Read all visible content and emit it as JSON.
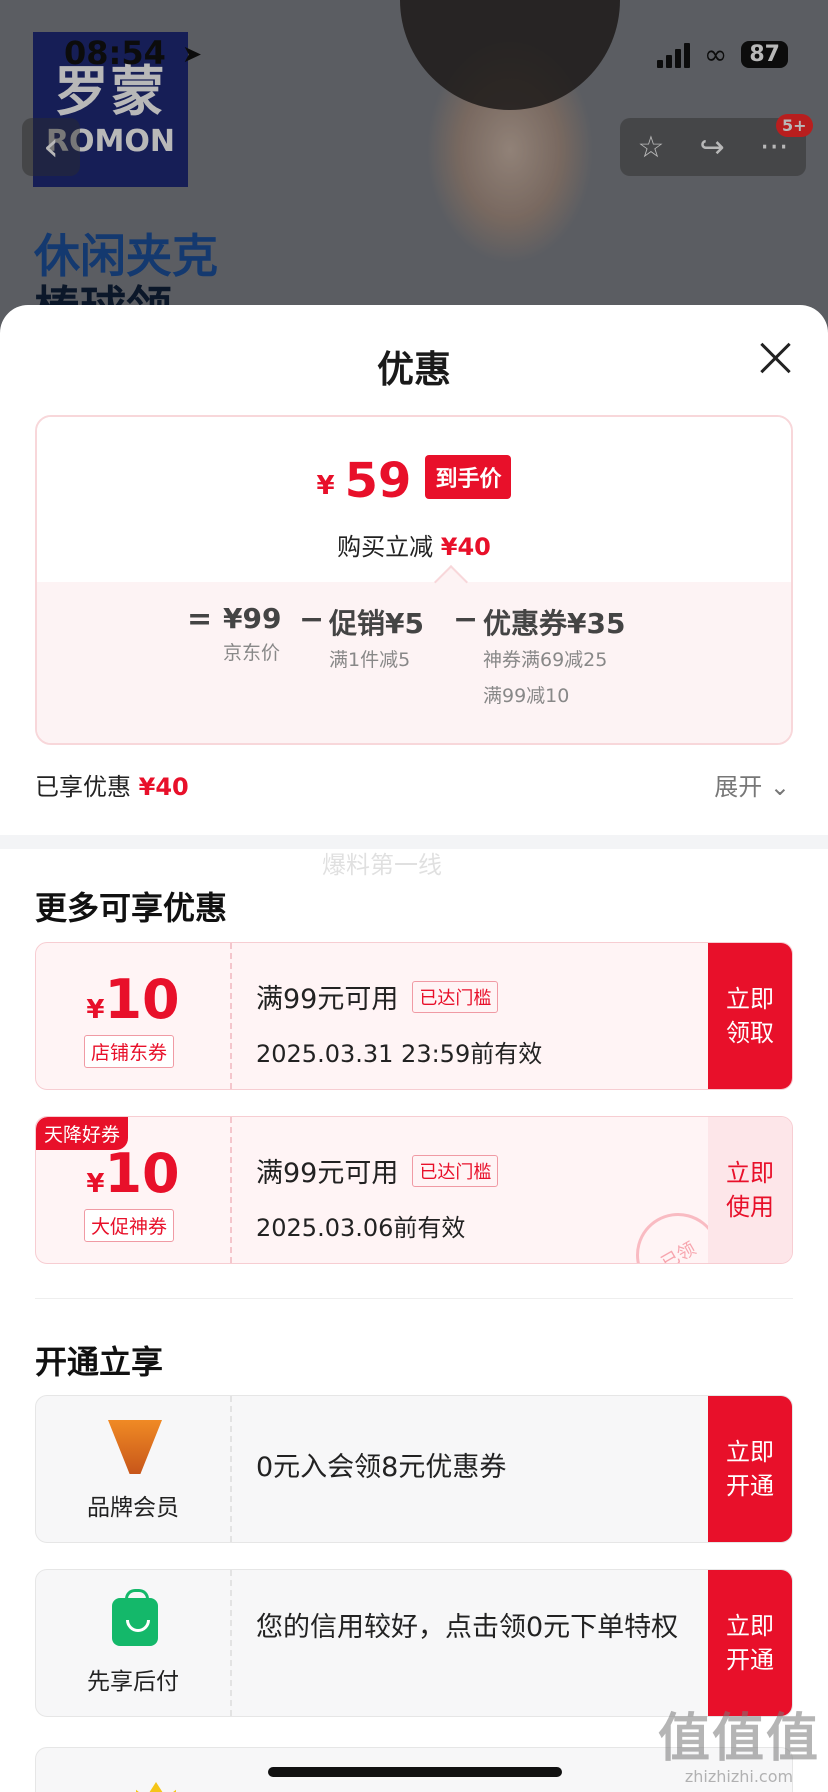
{
  "status_bar": {
    "time": "08:54",
    "battery": "87"
  },
  "background": {
    "brand_cn": "罗蒙",
    "brand_en": "ROMON",
    "promo_line1": "休闲夹克",
    "promo_line2": "棒球领",
    "cart_badge": "5+"
  },
  "sheet": {
    "title": "优惠",
    "price": {
      "currency": "¥",
      "amount": "59",
      "tag": "到手价"
    },
    "save_label": "购买立减",
    "save_amount": "¥40",
    "calc": {
      "equals": "=",
      "minus": "−",
      "jd_price": "¥99",
      "jd_price_label": "京东价",
      "promo": "促销¥5",
      "promo_note": "满1件减5",
      "coupon": "优惠券¥35",
      "coupon_note1": "神券满69减25",
      "coupon_note2": "满99减10"
    },
    "enjoyed_label": "已享优惠",
    "enjoyed_amount": "¥40",
    "expand_label": "展开"
  },
  "watermark": "爆料第一线",
  "more_section": {
    "title": "更多可享优惠",
    "coupons": [
      {
        "currency": "¥",
        "amount": "10",
        "kind": "店铺东券",
        "condition": "满99元可用",
        "status": "已达门槛",
        "expiry": "2025.03.31 23:59前有效",
        "button": "立即领取",
        "ribbon": ""
      },
      {
        "currency": "¥",
        "amount": "10",
        "kind": "大促神券",
        "condition": "满99元可用",
        "status": "已达门槛",
        "expiry": "2025.03.06前有效",
        "button": "立即使用",
        "ribbon": "天降好券",
        "stamp": "已领"
      }
    ]
  },
  "open_section": {
    "title": "开通立享",
    "items": [
      {
        "name": "品牌会员",
        "text": "0元入会领8元优惠券",
        "button": "立即开通"
      },
      {
        "name": "先享后付",
        "text": "您的信用较好，点击领0元下单特权",
        "button": "立即开通"
      }
    ]
  },
  "corner_watermark": {
    "big": "值值值",
    "small": "zhizhizhi.com"
  }
}
